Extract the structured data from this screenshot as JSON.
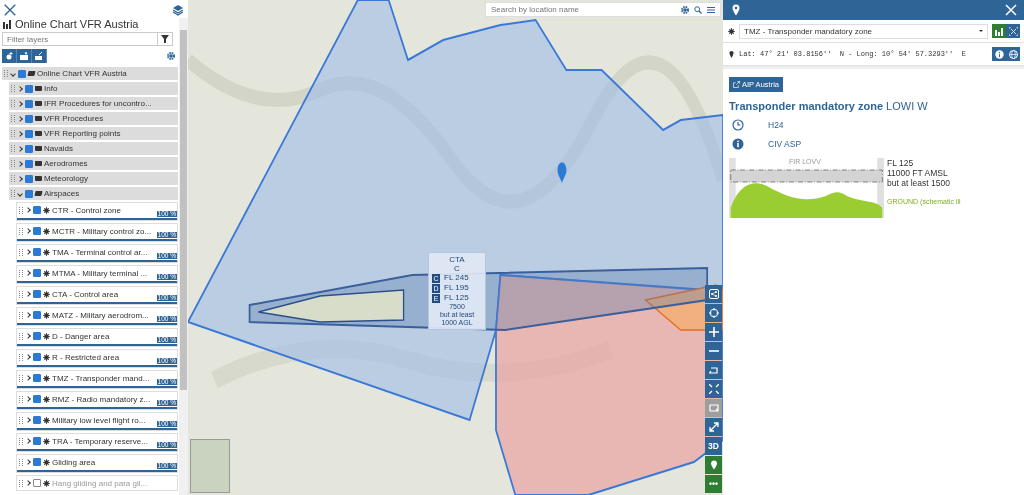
{
  "sidebar": {
    "title": "Online Chart VFR Austria",
    "filter": {
      "placeholder": "Filter layers"
    },
    "tree": [
      {
        "label": "Online Chart VFR Austria",
        "kind": "folder",
        "checked": true,
        "expanded": true,
        "children": [
          {
            "label": "Info",
            "kind": "folder",
            "checked": true,
            "expanded": false
          },
          {
            "label": "IFR Procedures for uncontro...",
            "kind": "folder",
            "checked": true,
            "expanded": false
          },
          {
            "label": "VFR Procedures",
            "kind": "folder",
            "checked": true,
            "expanded": false
          },
          {
            "label": "VFR Reporting points",
            "kind": "folder",
            "checked": true,
            "expanded": false
          },
          {
            "label": "Navaids",
            "kind": "folder",
            "checked": true,
            "expanded": false
          },
          {
            "label": "Aerodromes",
            "kind": "folder",
            "checked": true,
            "expanded": false
          },
          {
            "label": "Meteorology",
            "kind": "folder",
            "checked": true,
            "expanded": false
          },
          {
            "label": "Airspaces",
            "kind": "folder",
            "checked": true,
            "expanded": true,
            "children": [
              {
                "label": "CTR - Control zone",
                "kind": "layer",
                "checked": true,
                "expanded": false,
                "opacity": "100 %",
                "level": 1
              },
              {
                "label": "MCTR - Military control zo...",
                "kind": "layer",
                "checked": true,
                "expanded": false,
                "opacity": "100 %",
                "level": 1
              },
              {
                "label": "TMA - Terminal control ar...",
                "kind": "layer",
                "checked": true,
                "expanded": false,
                "opacity": "100 %",
                "level": 1
              },
              {
                "label": "MTMA - Military terminal ...",
                "kind": "layer",
                "checked": true,
                "expanded": false,
                "opacity": "100 %",
                "level": 1
              },
              {
                "label": "CTA - Control area",
                "kind": "layer",
                "checked": true,
                "expanded": false,
                "opacity": "100 %",
                "level": 1
              },
              {
                "label": "MATZ - Military aerodrom...",
                "kind": "layer",
                "checked": true,
                "expanded": false,
                "opacity": "100 %",
                "level": 1
              },
              {
                "label": "D - Danger area",
                "kind": "layer",
                "checked": true,
                "expanded": false,
                "opacity": "100 %",
                "level": 1
              },
              {
                "label": "R - Restricted area",
                "kind": "layer",
                "checked": true,
                "expanded": false,
                "opacity": "100 %",
                "level": 1
              },
              {
                "label": "TMZ - Transponder mand...",
                "kind": "layer",
                "checked": true,
                "expanded": false,
                "opacity": "100 %",
                "level": 1
              },
              {
                "label": "RMZ - Radio mandatory z...",
                "kind": "layer",
                "checked": true,
                "expanded": false,
                "opacity": "100 %",
                "level": 1
              },
              {
                "label": "Military low level flight ro...",
                "kind": "layer",
                "checked": true,
                "expanded": false,
                "opacity": "100 %",
                "level": 1
              },
              {
                "label": "TRA - Temporary reserve...",
                "kind": "layer",
                "checked": true,
                "expanded": false,
                "opacity": "100 %",
                "level": 1
              },
              {
                "label": "Gliding area",
                "kind": "layer",
                "checked": true,
                "expanded": false,
                "opacity": "100 %",
                "level": 1
              },
              {
                "label": "Hang gliding and para gli...",
                "kind": "layer",
                "checked": false,
                "expanded": false
              }
            ]
          }
        ]
      }
    ]
  },
  "map": {
    "search": {
      "placeholder": "Search by location name"
    },
    "popup": {
      "title": "CTA",
      "class": "C",
      "levels": [
        {
          "badge": "C",
          "text": "FL 245"
        },
        {
          "badge": "D",
          "text": "FL 195"
        },
        {
          "badge": "E",
          "text": "FL 125"
        }
      ],
      "notes": [
        "7500",
        "but at least",
        "1000 AGL"
      ]
    },
    "controls": [
      {
        "kind": "share",
        "disabled": false
      },
      {
        "kind": "locate",
        "disabled": false
      },
      {
        "kind": "zoom-in",
        "disabled": false
      },
      {
        "kind": "zoom-out",
        "disabled": false
      },
      {
        "kind": "rotate",
        "disabled": false
      },
      {
        "kind": "fit",
        "disabled": false
      },
      {
        "kind": "frame",
        "disabled": true
      },
      {
        "kind": "expand",
        "disabled": false
      },
      {
        "kind": "text",
        "label": "3D",
        "disabled": false
      },
      {
        "kind": "pin",
        "disabled": false
      },
      {
        "kind": "more",
        "label": "•••",
        "disabled": false
      }
    ]
  },
  "info_panel": {
    "feature_select": {
      "value": "TMZ - Transponder mandatory zone"
    },
    "coordinates": "Lat: 47° 21' 03.8156''  N - Long: 10° 54' 57.3293''  E",
    "link": "AIP Austria",
    "title": "**Transponder mandatory zone** LOWI W",
    "details": [
      {
        "kind": "time",
        "text": "H24"
      },
      {
        "kind": "info",
        "text": "CIV ASP"
      }
    ],
    "profile": {
      "fir": "FIR LOVV",
      "upper": [
        "FL 125",
        "11000 FT AMSL",
        "but at least 1500"
      ],
      "lower": "GROUND (schematic ill"
    }
  }
}
